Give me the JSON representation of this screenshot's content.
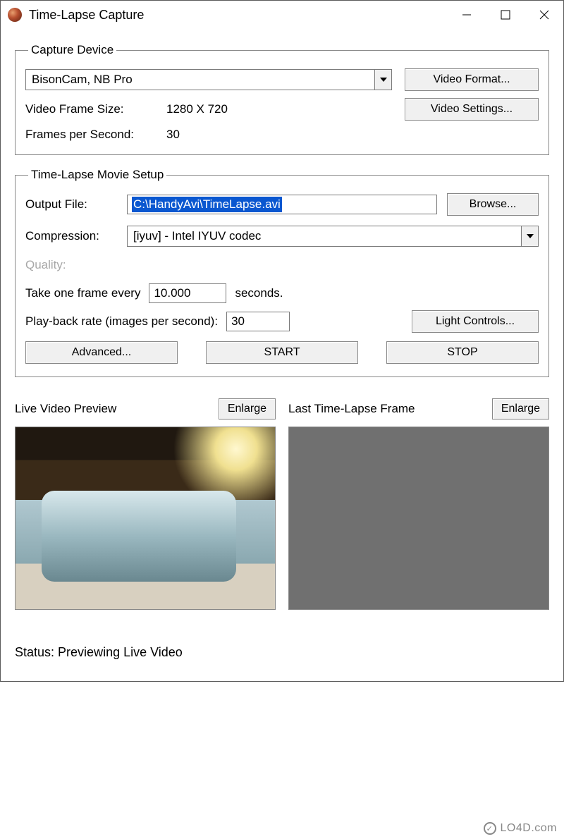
{
  "window": {
    "title": "Time-Lapse Capture"
  },
  "captureDevice": {
    "legend": "Capture Device",
    "deviceSelected": "BisonCam, NB Pro",
    "videoFormatBtn": "Video Format...",
    "videoSettingsBtn": "Video Settings...",
    "frameSizeLabel": "Video Frame Size:",
    "frameSizeValue": "1280 X 720",
    "fpsLabel": "Frames per Second:",
    "fpsValue": "30"
  },
  "movieSetup": {
    "legend": "Time-Lapse Movie Setup",
    "outputFileLabel": "Output File:",
    "outputFileValue": "C:\\HandyAvi\\TimeLapse.avi",
    "browseBtn": "Browse...",
    "compressionLabel": "Compression:",
    "compressionValue": "[iyuv] - Intel IYUV codec",
    "qualityLabel": "Quality:",
    "frameEveryPrefix": "Take one frame every",
    "frameEveryValue": "10.000",
    "frameEverySuffix": "seconds.",
    "playbackLabel": "Play-back rate (images per second):",
    "playbackValue": "30",
    "lightControlsBtn": "Light Controls...",
    "advancedBtn": "Advanced...",
    "startBtn": "START",
    "stopBtn": "STOP"
  },
  "previews": {
    "liveLabel": "Live Video Preview",
    "lastLabel": "Last Time-Lapse Frame",
    "enlargeBtn": "Enlarge"
  },
  "status": {
    "label": "Status:",
    "value": "Previewing Live Video"
  },
  "watermark": "LO4D.com"
}
